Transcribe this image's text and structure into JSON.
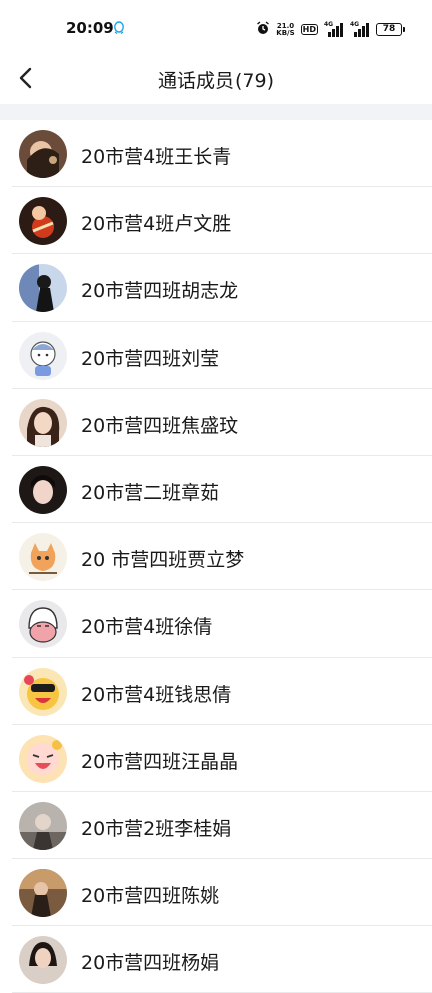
{
  "status_bar": {
    "time": "20:09",
    "net_speed_value": "21.0",
    "net_speed_unit": "KB/S",
    "hd_label": "HD",
    "signal1_tag": "4G",
    "signal2_tag": "4G",
    "battery": "78"
  },
  "header": {
    "back_icon": "chevron-left-icon",
    "title": "通话成员",
    "count": "(79)"
  },
  "members": [
    {
      "name": "20市营4班王长青"
    },
    {
      "name": "20市营4班卢文胜"
    },
    {
      "name": "20市营四班胡志龙"
    },
    {
      "name": "20市营四班刘莹"
    },
    {
      "name": "20市营四班焦盛玟"
    },
    {
      "name": "20市营二班章茹"
    },
    {
      "name": "20 市营四班贾立梦"
    },
    {
      "name": "20市营4班徐倩"
    },
    {
      "name": "20市营4班钱思倩"
    },
    {
      "name": "20市营四班汪晶晶"
    },
    {
      "name": "20市营2班李桂娟"
    },
    {
      "name": "20市营四班陈姚"
    },
    {
      "name": "20市营四班杨娟"
    }
  ],
  "colors": {
    "divider": "#f1f3f7",
    "text": "#1a1a1a",
    "separator": "#e9e9ec"
  }
}
